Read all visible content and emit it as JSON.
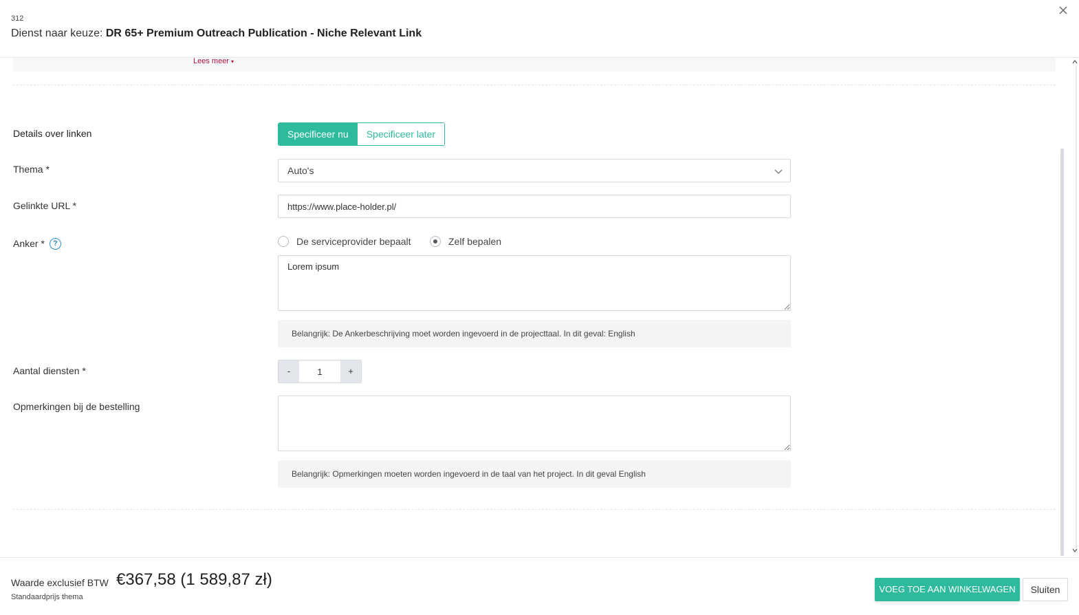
{
  "header": {
    "order_id": "312",
    "title_prefix": "Dienst naar keuze:",
    "service_name": "DR 65+ Premium Outreach Publication - Niche Relevant Link"
  },
  "read_more": "Lees meer",
  "form": {
    "link_details": {
      "label": "Details over linken",
      "options": [
        "Specificeer nu",
        "Specificeer later"
      ],
      "selected": "Specificeer nu"
    },
    "theme": {
      "label": "Thema *",
      "value": "Auto's"
    },
    "linked_url": {
      "label": "Gelinkte URL *",
      "value": "https://www.place-holder.pl/"
    },
    "anchor": {
      "label": "Anker *",
      "help": "?",
      "radio_provider": "De serviceprovider bepaalt",
      "radio_self": "Zelf bepalen",
      "selected": "Zelf bepalen",
      "value": "Lorem ipsum",
      "note": "Belangrijk: De Ankerbeschrijving moet worden ingevoerd in de projecttaal. In dit geval: English"
    },
    "quantity": {
      "label": "Aantal diensten *",
      "minus": "-",
      "value": "1",
      "plus": "+"
    },
    "remarks": {
      "label": "Opmerkingen bij de bestelling",
      "value": "",
      "note": "Belangrijk: Opmerkingen moeten worden ingevoerd in de taal van het project. In dit geval English"
    }
  },
  "footer": {
    "price_label": "Waarde exclusief BTW",
    "price_value": "€367,58 (1 589,87 zł)",
    "price_sub": "Standaardprijs thema",
    "add_to_cart": "VOEG TOE AAN WINKELWAGEN",
    "close": "Sluiten"
  },
  "colors": {
    "accent": "#2ebb9d",
    "link_red": "#b3143a",
    "help_blue": "#2b8fd6"
  },
  "icons": {
    "close": "close-icon",
    "chevron": "chevron-down-icon",
    "help": "question-circle-icon"
  }
}
